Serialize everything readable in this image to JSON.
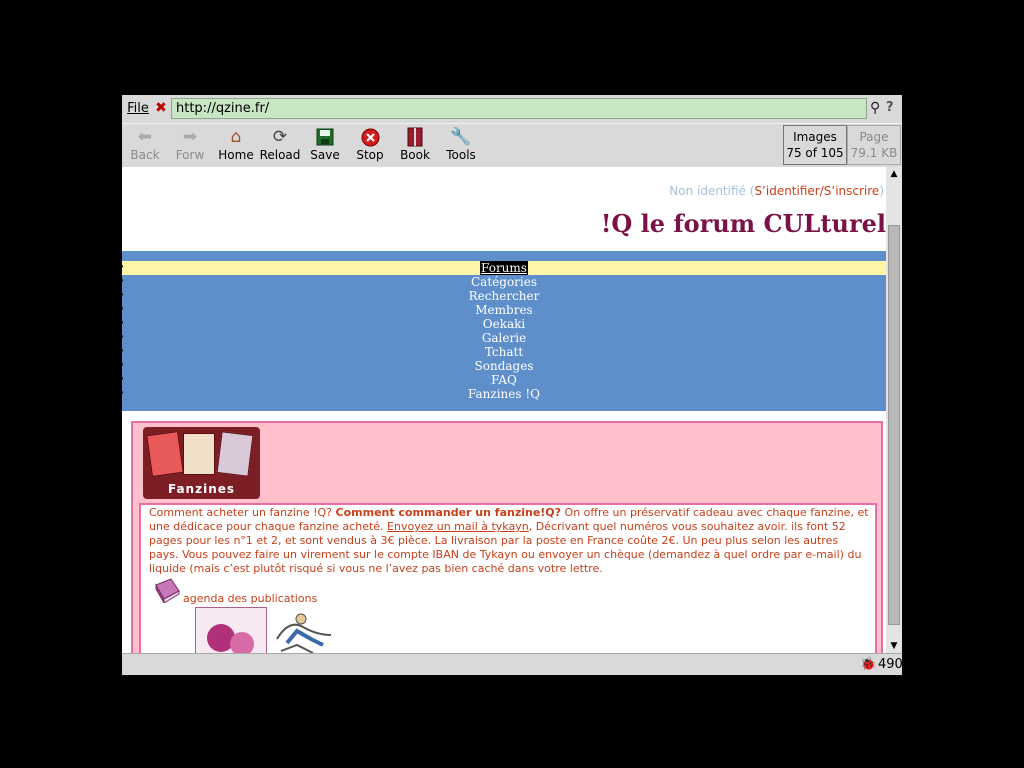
{
  "urlbar": {
    "file_label": "File",
    "url": "http://qzine.fr/",
    "close_icon": "stop-x-icon",
    "search_icon": "search-icon",
    "help_icon": "help-icon"
  },
  "toolbar": {
    "buttons": [
      {
        "label": "Back",
        "icon": "back-arrow-icon",
        "disabled": true
      },
      {
        "label": "Forw",
        "icon": "forward-arrow-icon",
        "disabled": true
      },
      {
        "label": "Home",
        "icon": "home-icon",
        "disabled": false
      },
      {
        "label": "Reload",
        "icon": "reload-icon",
        "disabled": false
      },
      {
        "label": "Save",
        "icon": "save-icon",
        "disabled": false
      },
      {
        "label": "Stop",
        "icon": "stop-icon",
        "disabled": false
      },
      {
        "label": "Book",
        "icon": "bookmark-icon",
        "disabled": false
      },
      {
        "label": "Tools",
        "icon": "tools-icon",
        "disabled": false
      }
    ],
    "images_label": "Images",
    "images_count": "75 of 105",
    "page_label": "Page",
    "page_size": "79.1 KB"
  },
  "page": {
    "login_status": "Non identifié",
    "login_open": "(",
    "login_link": "S’identifier/S’inscrire",
    "login_close": ")",
    "site_title": "!Q le forum CULturel",
    "nav": [
      "Forums",
      "Catégories",
      "Rechercher",
      "Membres",
      "Oekaki",
      "Galerie",
      "Tchatt",
      "Sondages",
      "FAQ",
      "Fanzines !Q"
    ],
    "banner_label": "Fanzines",
    "intro_1": "Comment acheter un fanzine !Q? ",
    "intro_bold": "Comment commander un fanzine!Q?",
    "intro_2": " On offre un préservatif cadeau avec chaque fanzine, et une dédicace pour chaque fanzine acheté. ",
    "intro_link": "Envoyez un mail à tykayn",
    "intro_3": ", Décrivant quel numéros vous souhaitez avoir. ils font 52 pages pour les n°1 et 2, et sont vendus à 3€ pièce. La livraison par la poste en France coûte 2€. Un peu plus selon les autres pays. Vous pouvez faire un virement sur le compte IBAN de Tykayn ou envoyer un chèque (demandez à quel ordre par e-mail) du liquide (mais c’est plutôt risqué si vous ne l’avez pas bien caché dans votre lettre.",
    "agenda_label": "agenda des publications"
  },
  "status": {
    "bug_icon": "bug-icon",
    "count": "490"
  },
  "colors": {
    "nav_bg": "#5e8fcb",
    "nav_active": "#fff5a6",
    "title": "#7a1248",
    "text": "#c8401a",
    "pink": "#ffc0cb",
    "pink_border": "#e76fa5",
    "url_bg": "#c8e6c4"
  }
}
